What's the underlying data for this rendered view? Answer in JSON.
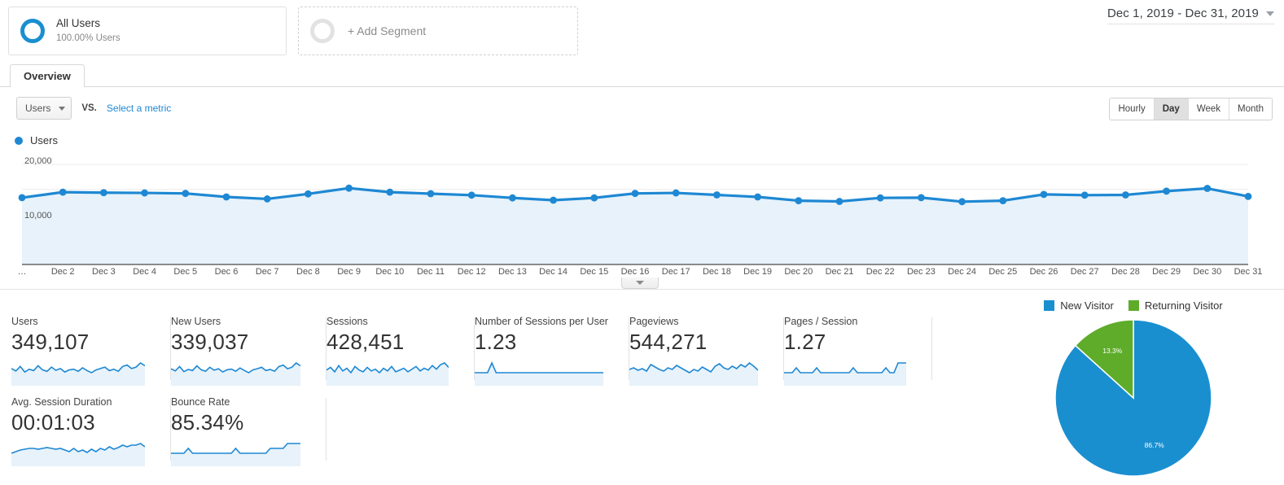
{
  "segments": {
    "all_users": {
      "title": "All Users",
      "subtitle": "100.00% Users"
    },
    "add_segment_label": "+ Add Segment"
  },
  "date_range": {
    "label": "Dec 1, 2019 - Dec 31, 2019"
  },
  "tabs": [
    {
      "label": "Overview",
      "active": true
    }
  ],
  "metric_selector": {
    "selected": "Users",
    "vs_label": "VS.",
    "compare_link": "Select a metric"
  },
  "granularity": {
    "options": [
      "Hourly",
      "Day",
      "Week",
      "Month"
    ],
    "selected": "Day"
  },
  "series_legend": {
    "label": "Users",
    "color": "#1e88d3"
  },
  "collapse_handle": {
    "icon": "chevron-down-icon"
  },
  "metrics": [
    {
      "name": "Users",
      "value": "349,107",
      "spark": [
        62,
        55,
        68,
        52,
        60,
        56,
        70,
        58,
        54,
        66,
        57,
        62,
        52,
        58,
        60,
        54,
        64,
        56,
        50,
        58,
        62,
        66,
        56,
        60,
        54,
        68,
        72,
        62,
        66,
        78,
        70
      ]
    },
    {
      "name": "New Users",
      "value": "339,037",
      "spark": [
        60,
        54,
        66,
        52,
        58,
        55,
        68,
        57,
        53,
        64,
        56,
        60,
        51,
        57,
        59,
        53,
        62,
        55,
        49,
        57,
        60,
        64,
        55,
        58,
        53,
        66,
        70,
        60,
        64,
        76,
        68
      ]
    },
    {
      "name": "Sessions",
      "value": "428,451",
      "spark": [
        58,
        64,
        54,
        68,
        56,
        62,
        52,
        66,
        58,
        54,
        64,
        56,
        60,
        52,
        62,
        56,
        66,
        54,
        58,
        62,
        54,
        60,
        66,
        56,
        62,
        58,
        68,
        60,
        70,
        74,
        64
      ]
    },
    {
      "name": "Number of Sessions per User",
      "value": "1.23",
      "spark": [
        60,
        60,
        60,
        60,
        61,
        60,
        60,
        60,
        60,
        60,
        60,
        60,
        60,
        60,
        60,
        60,
        60,
        60,
        60,
        60,
        60,
        60,
        60,
        60,
        60,
        60,
        60,
        60,
        60,
        60,
        60
      ]
    },
    {
      "name": "Pageviews",
      "value": "544,271",
      "spark": [
        58,
        62,
        56,
        60,
        54,
        70,
        64,
        58,
        54,
        62,
        58,
        68,
        62,
        56,
        50,
        58,
        54,
        64,
        58,
        52,
        66,
        72,
        62,
        58,
        66,
        60,
        70,
        64,
        74,
        66,
        56
      ]
    },
    {
      "name": "Pages / Session",
      "value": "1.27",
      "spark": [
        60,
        60,
        60,
        61,
        60,
        60,
        60,
        60,
        61,
        60,
        60,
        60,
        60,
        60,
        60,
        60,
        60,
        61,
        60,
        60,
        60,
        60,
        60,
        60,
        60,
        61,
        60,
        60,
        62,
        62,
        62
      ]
    },
    {
      "name": "Avg. Session Duration",
      "value": "00:01:03",
      "spark": [
        56,
        58,
        60,
        61,
        62,
        62,
        61,
        62,
        63,
        62,
        61,
        62,
        60,
        58,
        62,
        58,
        60,
        57,
        61,
        58,
        62,
        60,
        64,
        61,
        63,
        66,
        64,
        66,
        66,
        68,
        64
      ]
    },
    {
      "name": "Bounce Rate",
      "value": "85.34%",
      "spark": [
        62,
        62,
        62,
        62,
        63,
        62,
        62,
        62,
        62,
        62,
        62,
        62,
        62,
        62,
        62,
        63,
        62,
        62,
        62,
        62,
        62,
        62,
        62,
        63,
        63,
        63,
        63,
        64,
        64,
        64,
        64
      ]
    }
  ],
  "chart_data": {
    "type": "line",
    "title": "Users",
    "xlabel": "",
    "ylabel": "Users",
    "ylim": [
      0,
      20000
    ],
    "y_ticks": [
      {
        "label": "20,000",
        "value": 20000
      },
      {
        "label": "10,000",
        "value": 10000
      }
    ],
    "grid": true,
    "legend": "top-left",
    "series": [
      {
        "name": "Users",
        "color": "#1e88d3",
        "fill": "#e7f2fa",
        "values": [
          13350,
          14450,
          14350,
          14300,
          14200,
          13500,
          13100,
          14100,
          15250,
          14450,
          14150,
          13850,
          13300,
          12850,
          13300,
          14200,
          14300,
          13900,
          13500,
          12750,
          12600,
          13300,
          13350,
          12550,
          12750,
          14000,
          13850,
          13900,
          14650,
          15200,
          13600
        ]
      }
    ],
    "categories": [
      "…",
      "Dec 2",
      "Dec 3",
      "Dec 4",
      "Dec 5",
      "Dec 6",
      "Dec 7",
      "Dec 8",
      "Dec 9",
      "Dec 10",
      "Dec 11",
      "Dec 12",
      "Dec 13",
      "Dec 14",
      "Dec 15",
      "Dec 16",
      "Dec 17",
      "Dec 18",
      "Dec 19",
      "Dec 20",
      "Dec 21",
      "Dec 22",
      "Dec 23",
      "Dec 24",
      "Dec 25",
      "Dec 26",
      "Dec 27",
      "Dec 28",
      "Dec 29",
      "Dec 30",
      "Dec 31"
    ]
  },
  "pie_chart": {
    "type": "pie",
    "legend_position": "top",
    "slices": [
      {
        "name": "New Visitor",
        "value": 86.7,
        "label": "86.7%",
        "color": "#1a8fd0"
      },
      {
        "name": "Returning Visitor",
        "value": 13.3,
        "label": "13.3%",
        "color": "#5eac2a"
      }
    ]
  }
}
